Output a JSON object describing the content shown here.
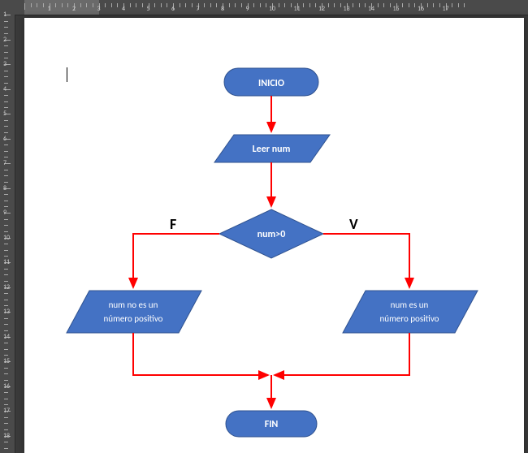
{
  "flowchart": {
    "start_label": "INICIO",
    "end_label": "FIN",
    "input_label": "Leer num",
    "decision_label": "num>0",
    "false_branch_label": "F",
    "true_branch_label": "V",
    "false_result_line1": "num no es un",
    "false_result_line2": "número positivo",
    "true_result_line1": "num es un",
    "true_result_line2": "número positivo"
  },
  "ruler": {
    "h_numbers": [
      "3",
      "2",
      "1",
      "",
      "1",
      "2",
      "3",
      "4",
      "5",
      "6",
      "7",
      "8",
      "9",
      "10",
      "11",
      "12",
      "13",
      "14",
      "15",
      "16",
      "17"
    ],
    "v_start": 1
  }
}
